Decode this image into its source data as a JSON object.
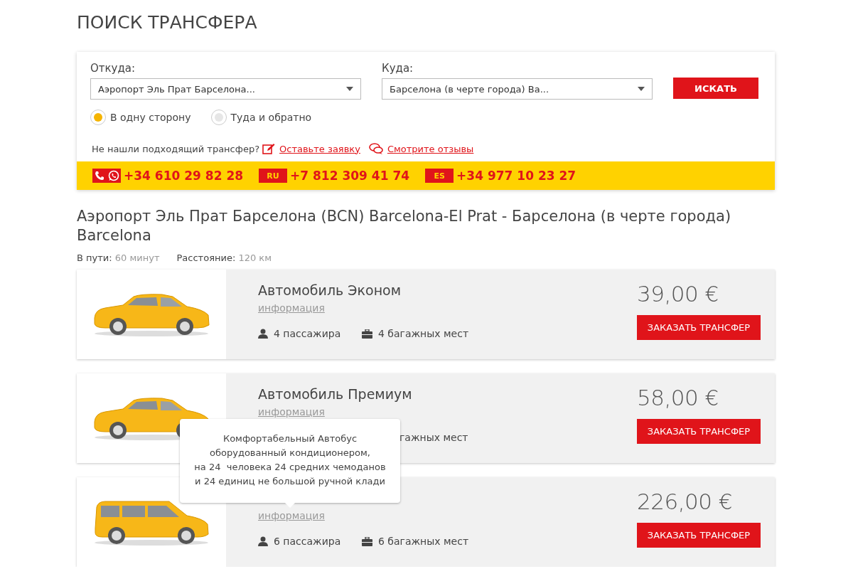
{
  "page_title": "ПОИСК ТРАНСФЕРА",
  "search": {
    "from": {
      "label": "Откуда:",
      "value": "Аэропорт Эль Прат Барселона..."
    },
    "to": {
      "label": "Куда:",
      "value": "Барселона (в черте города) Ва..."
    },
    "button": "ИСКАТЬ",
    "trip_types": [
      {
        "label": "В одну сторону",
        "selected": true
      },
      {
        "label": "Туда и обратно",
        "selected": false
      }
    ],
    "help": {
      "text": "Не нашли подходящий трансфер?",
      "links": [
        {
          "kind": "request",
          "label": "Оставьте заявку"
        },
        {
          "kind": "reviews",
          "label": "Смотрите отзывы"
        }
      ]
    }
  },
  "phones": [
    {
      "kind": "messenger",
      "number": "+34 610 29 82 28"
    },
    {
      "kind": "flag",
      "flag": "RU",
      "number": "+7 812 309 41 74"
    },
    {
      "kind": "flag",
      "flag": "ES",
      "number": "+34 977 10 23 27"
    }
  ],
  "route": {
    "title": "Аэропорт Эль Прат Барселона (BCN) Barcelona-El Prat - Барселона (в черте города) Barcelona",
    "duration_label": "В пути:",
    "duration": "60 минут",
    "distance_label": "Расстояние:",
    "distance": "120 км"
  },
  "vehicles": [
    {
      "kind": "sedan",
      "name": "Автомобиль Эконом",
      "info": "информация",
      "price": "39,00 €",
      "button": "ЗАКАЗАТЬ ТРАНСФЕР",
      "features": [
        {
          "kind": "passengers",
          "text": "4 пассажира"
        },
        {
          "kind": "luggage",
          "text": "4 багажных мест"
        }
      ]
    },
    {
      "kind": "sedan",
      "name": "Автомобиль Премиум",
      "info": "информация",
      "price": "58,00 €",
      "button": "ЗАКАЗАТЬ ТРАНСФЕР",
      "features": [
        {
          "kind": "covered",
          "text": "гажных мест"
        }
      ]
    },
    {
      "kind": "minivan",
      "info": "информация",
      "price": "226,00 €",
      "button": "ЗАКАЗАТЬ ТРАНСФЕР",
      "features": [
        {
          "kind": "passengers",
          "text": "6 пассажира"
        },
        {
          "kind": "luggage",
          "text": "6 багажных мест"
        }
      ],
      "tooltip": "Комфортабельный Автобус\nоборудованный кондиционером,\nна 24  человека 24 средних чемоданов\nи 24 единиц не большой ручной клади"
    }
  ]
}
